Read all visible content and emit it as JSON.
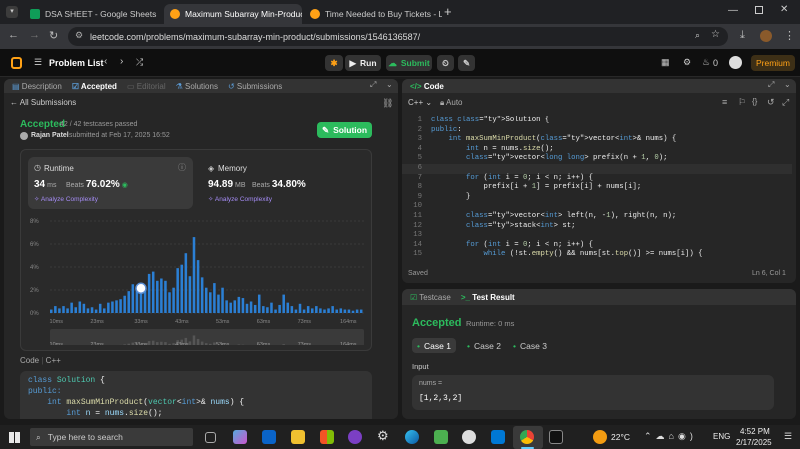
{
  "tabs": [
    {
      "title": "DSA SHEET - Google Sheets",
      "icon": "sheets-icon",
      "color": "#0f9d58"
    },
    {
      "title": "Maximum Subarray Min-Produc",
      "icon": "leetcode-icon",
      "color": "#ffa116"
    },
    {
      "title": "Time Needed to Buy Tickets - L",
      "icon": "leetcode-icon",
      "color": "#ffa116"
    }
  ],
  "url": "leetcode.com/problems/maximum-subarray-min-product/submissions/1546136587/",
  "lc": {
    "problem_list": "Problem List",
    "run": "Run",
    "submit": "Submit",
    "coins": "0",
    "premium": "Premium"
  },
  "left_tabs": [
    "Description",
    "Accepted",
    "Editorial",
    "Solutions",
    "Submissions"
  ],
  "all_submissions": "All Submissions",
  "result": {
    "status": "Accepted",
    "passed": "42 / 42 testcases passed",
    "user": "Rajan Patel",
    "submitted": "submitted at Feb 17, 2025 16:52",
    "solution_btn": "Solution"
  },
  "runtime": {
    "label": "Runtime",
    "value": "34",
    "unit": "ms",
    "beats_label": "Beats",
    "beats": "76.02%",
    "analyze": "Analyze Complexity"
  },
  "memory": {
    "label": "Memory",
    "value": "94.89",
    "unit": "MB",
    "beats_label": "Beats",
    "beats": "34.80%",
    "analyze": "Analyze Complexity"
  },
  "chart_data": {
    "type": "bar",
    "y_ticks": [
      "8%",
      "6%",
      "4%",
      "2%",
      "0%"
    ],
    "x_ticks": [
      "10ms",
      "23ms",
      "33ms",
      "43ms",
      "53ms",
      "63ms",
      "73ms",
      "164ms"
    ],
    "values": [
      0.3,
      0.6,
      0.4,
      0.6,
      0.4,
      0.9,
      0.5,
      1.0,
      0.8,
      0.4,
      0.5,
      0.3,
      0.8,
      0.4,
      0.9,
      1.0,
      1.1,
      1.2,
      1.5,
      1.9,
      2.5,
      2.2,
      1.8,
      2.0,
      3.4,
      3.6,
      2.8,
      3.0,
      2.8,
      1.8,
      2.2,
      3.9,
      4.2,
      5.2,
      3.2,
      6.6,
      4.6,
      3.1,
      2.2,
      1.8,
      2.6,
      1.6,
      2.2,
      1.1,
      0.9,
      1.1,
      1.4,
      1.3,
      0.8,
      1.0,
      0.7,
      1.6,
      0.6,
      0.5,
      0.9,
      0.3,
      0.7,
      1.6,
      0.9,
      0.6,
      0.3,
      0.8,
      0.3,
      0.6,
      0.4,
      0.6,
      0.4,
      0.3,
      0.4,
      0.6,
      0.3,
      0.4,
      0.3,
      0.3,
      0.2,
      0.3,
      0.3
    ],
    "highlight_index": 22,
    "ylim": [
      0,
      8
    ]
  },
  "bottom_code": {
    "label": "Code",
    "lang": "C++",
    "lines": [
      "class Solution {",
      "public:",
      "    int maxSumMinProduct(vector<int>& nums) {",
      "        int n = nums.size();"
    ]
  },
  "editor": {
    "title": "Code",
    "lang": "C++",
    "mode": "Auto",
    "saved": "Saved",
    "cursor": "Ln 6, Col 1"
  },
  "code_lines": [
    "class Solution {",
    "public:",
    "    int maxSumMinProduct(vector<int>& nums) {",
    "        int n = nums.size();",
    "        vector<long long> prefix(n + 1, 0);",
    "",
    "        for (int i = 0; i < n; i++) {",
    "            prefix[i + 1] = prefix[i] + nums[i];",
    "        }",
    "",
    "        vector<int> left(n, -1), right(n, n);",
    "        stack<int> st;",
    "",
    "        for (int i = 0; i < n; i++) {",
    "            while (!st.empty() && nums[st.top()] >= nums[i]) {"
  ],
  "test": {
    "tab1": "Testcase",
    "tab2": "Test Result",
    "status": "Accepted",
    "runtime": "Runtime: 0 ms",
    "cases": [
      "Case 1",
      "Case 2",
      "Case 3"
    ],
    "input_label": "Input",
    "var": "nums =",
    "value": "[1,2,3,2]"
  },
  "taskbar": {
    "search": "Type here to search",
    "temp": "22°C",
    "lang": "ENG",
    "time": "4:52 PM",
    "date": "2/17/2025"
  }
}
